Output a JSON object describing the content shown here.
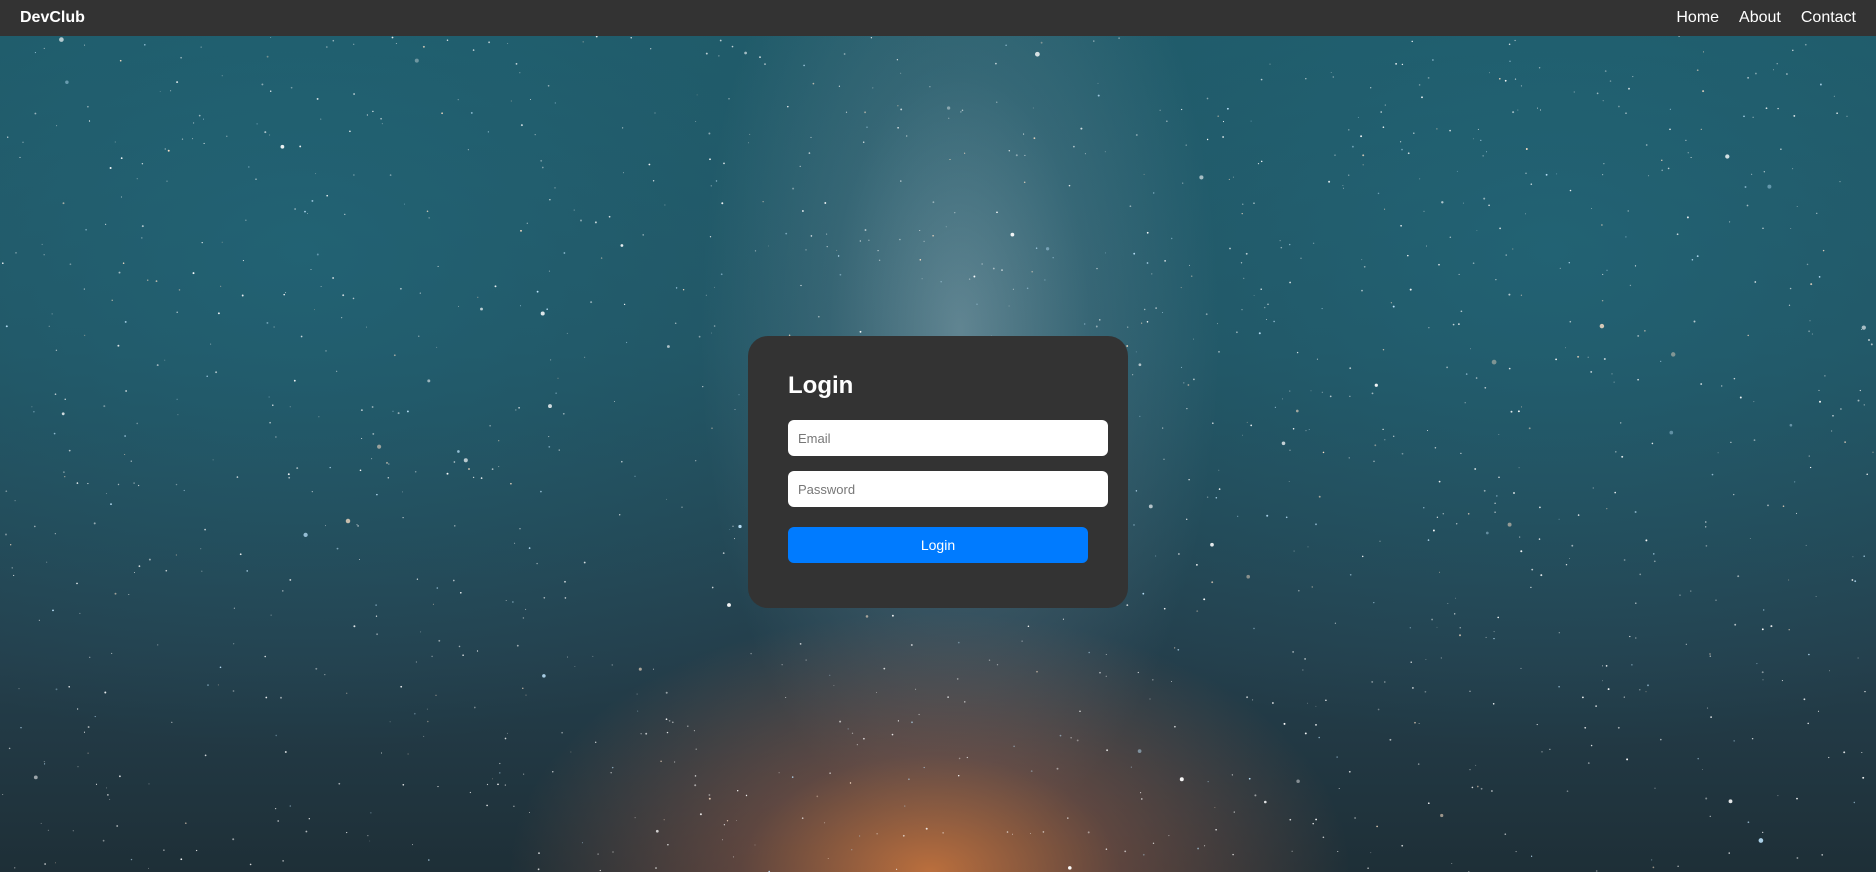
{
  "navbar": {
    "brand": "DevClub",
    "links": [
      "Home",
      "About",
      "Contact"
    ]
  },
  "login": {
    "title": "Login",
    "email_placeholder": "Email",
    "password_placeholder": "Password",
    "button_label": "Login"
  },
  "colors": {
    "navbar_bg": "#333333",
    "card_bg": "#333333",
    "button_bg": "#007bff"
  }
}
